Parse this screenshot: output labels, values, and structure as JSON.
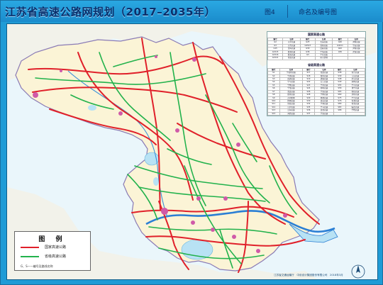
{
  "header": {
    "title": "江苏省高速公路网规划（2017–2035年）",
    "figure_no": "图4",
    "figure_title": "命名及编号图"
  },
  "tables": {
    "national_caption": "国家高速公路",
    "national_headers": [
      "编号",
      "名称",
      "编号",
      "名称",
      "编号",
      "名称"
    ],
    "national_rows": [
      [
        "G2",
        "京沪高速",
        "G25",
        "长深高速",
        "G40",
        "沪陕高速"
      ],
      [
        "G3",
        "京台高速",
        "G2513",
        "淮徐高速",
        "G4211",
        "宁芜高速"
      ],
      [
        "G15",
        "沈海高速",
        "G30",
        "连霍高速",
        "G42",
        "沪蓉高速"
      ],
      [
        "G1515",
        "盐靖高速",
        "G36",
        "宁洛高速",
        "G50",
        "沪渝高速"
      ],
      [
        "G1516",
        "盐洛高速",
        "G3",
        "宁宣高速",
        "",
        ""
      ],
      [
        "G1521",
        "常嘉高速",
        "",
        "南京绕城",
        "",
        ""
      ]
    ],
    "provincial_caption": "省级高速公路",
    "provincial_headers": [
      "编号",
      "名称",
      "编号",
      "名称",
      "编号",
      "名称"
    ],
    "provincial_rows": [
      [
        "S1",
        "宁宿徐高速",
        "S17",
        "淮盐高速",
        "S38",
        "常合高速"
      ],
      [
        "S2",
        "宁通高速",
        "S18",
        "盐射高速",
        "S39",
        "江宜高速"
      ],
      [
        "S3",
        "南通高速",
        "S19",
        "通锡高速",
        "S48",
        "沪宜高速"
      ],
      [
        "S4",
        "宁马高速",
        "S22",
        "沿江高速",
        "S49",
        "新扬高速"
      ],
      [
        "S5",
        "宁杭高速",
        "S23",
        "宁常高速",
        "S55",
        "宁宣高速"
      ],
      [
        "S6",
        "宁淮高速",
        "S24",
        "徐明高速",
        "S58",
        "溧宁高速"
      ],
      [
        "S7",
        "淮连高速",
        "S26",
        "宁洛高速",
        "S65",
        "徐宿高速"
      ],
      [
        "S8",
        "盐徐高速",
        "S28",
        "宁扬高速",
        "S69",
        "济徐高速"
      ],
      [
        "S9",
        "苏州绕城",
        "S29",
        "扬溧高速",
        "S75",
        "宁合高速"
      ],
      [
        "S10",
        "启扬高速",
        "S30",
        "锡宜高速",
        "S76",
        "常溧高速"
      ],
      [
        "S11",
        "常嘉高速",
        "S32",
        "宁靖高速",
        "S80",
        "徐淮高速"
      ],
      [
        "S12",
        "京沪高速",
        "S35",
        "宁马高速",
        "S83",
        "临连高速"
      ],
      [
        "S13",
        "沿海高速",
        "S36",
        "连淮高速",
        "S88",
        "宁杭高速"
      ],
      [
        "S15",
        "海启高速",
        "S37",
        "宁洛高速",
        "",
        ""
      ]
    ]
  },
  "legend": {
    "title": "图 例",
    "items": [
      {
        "label": "国家高速公路",
        "color": "#e0202a"
      },
      {
        "label": "省级高速公路",
        "color": "#22b24c"
      }
    ],
    "note": "G、S——编号及路线名称"
  },
  "footer": "江苏省交通运输厅　中设设计集团股份有限公司　2018年3月",
  "colors": {
    "frame": "#1f9bd6",
    "land": "#fbf4d6",
    "water": "#b8e2f4",
    "national": "#e0202a",
    "provincial": "#22b24c",
    "river": "#2b7fd4"
  }
}
